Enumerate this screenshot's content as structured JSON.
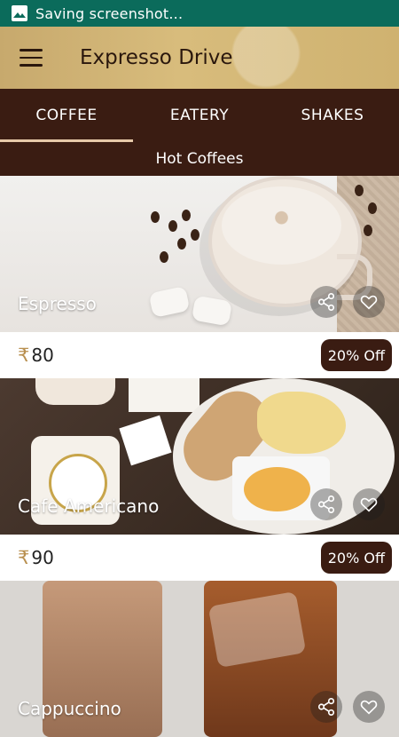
{
  "status_bar": {
    "text": "Saving screenshot..."
  },
  "app_bar": {
    "title": "Expresso Drive"
  },
  "tabs": [
    {
      "label": "COFFEE",
      "active": true
    },
    {
      "label": "EATERY",
      "active": false
    },
    {
      "label": "SHAKES",
      "active": false
    }
  ],
  "subheader": "Hot Coffees",
  "items": [
    {
      "name": "Espresso",
      "currency": "₹",
      "price": "80",
      "offer": "20% Off"
    },
    {
      "name": "Cafe Americano",
      "currency": "₹",
      "price": "90",
      "offer": "20% Off"
    },
    {
      "name": "Cappuccino"
    }
  ],
  "colors": {
    "status_bar": "#0b6b5b",
    "app_bar": "#d2b676",
    "tabs_bg": "#3a1c12",
    "offer_bg": "#3a1c12",
    "rupee": "#b99050"
  },
  "icons": {
    "status": "image-icon",
    "menu": "hamburger-menu-icon",
    "share": "share-icon",
    "favorite": "heart-outline-icon"
  }
}
